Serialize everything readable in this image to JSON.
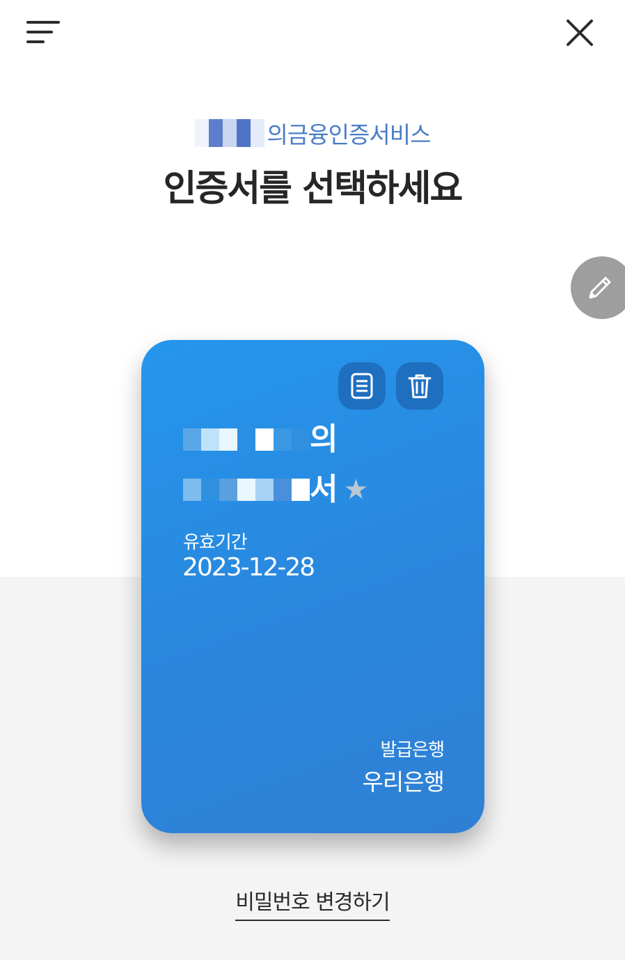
{
  "header": {
    "menu_icon": "menu-icon",
    "close_icon": "close-icon"
  },
  "service": {
    "title": "의금융인증서비스"
  },
  "page_title": "인증서를 선택하세요",
  "edit_button": {
    "icon": "pencil-icon"
  },
  "certificate": {
    "name_line1_suffix": "의",
    "name_line2_suffix": "서",
    "favorite_icon": "star-icon",
    "detail_icon": "document-icon",
    "delete_icon": "trash-icon",
    "validity_label": "유효기간",
    "validity_date": "2023-12-28",
    "issuer_label": "발급은행",
    "issuer_name": "우리은행"
  },
  "change_password_link": "비밀번호 변경하기",
  "colors": {
    "accent_text": "#4a7cc7",
    "card_blue": "#2a86dd",
    "card_button": "#1f6fc0",
    "fab_gray": "#9e9e9e",
    "bottom_band": "#f4f4f4"
  }
}
